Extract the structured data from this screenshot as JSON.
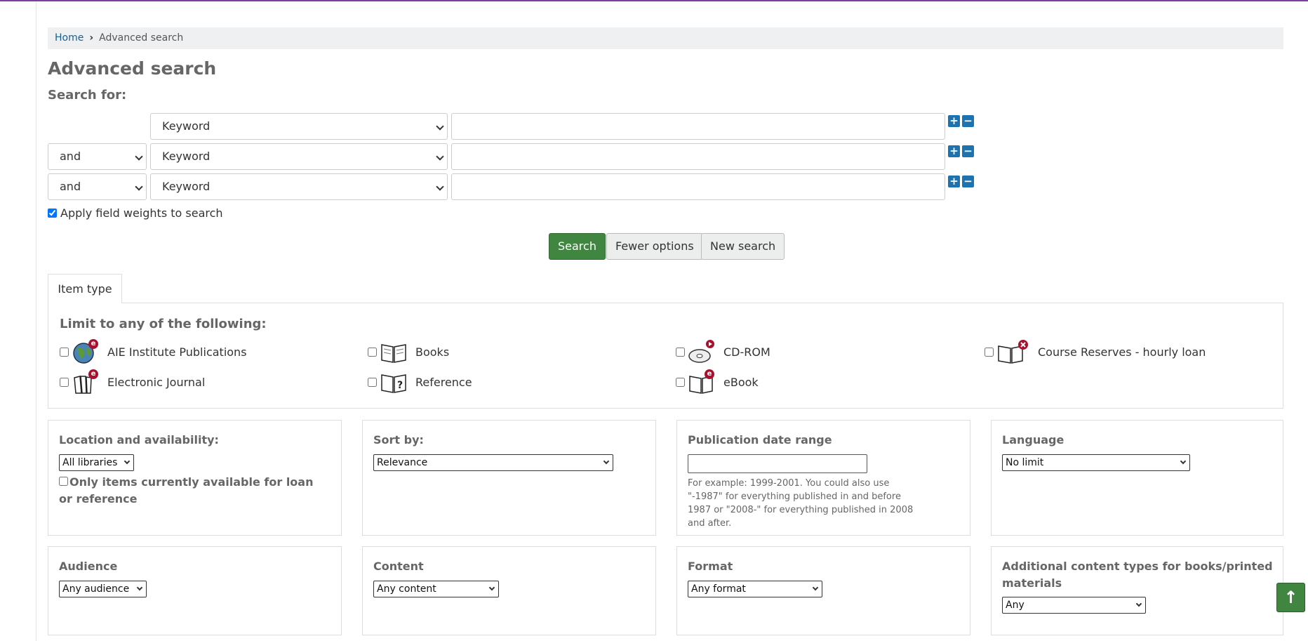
{
  "breadcrumb": {
    "home": "Home",
    "current": "Advanced search"
  },
  "page_title": "Advanced search",
  "search_for_label": "Search for:",
  "rows": [
    {
      "operator": "",
      "index": "Keyword",
      "term": ""
    },
    {
      "operator": "and",
      "index": "Keyword",
      "term": ""
    },
    {
      "operator": "and",
      "index": "Keyword",
      "term": ""
    }
  ],
  "plus": "+",
  "minus": "−",
  "apply_weights": "Apply field weights to search",
  "buttons": {
    "search": "Search",
    "fewer": "Fewer options",
    "new": "New search"
  },
  "tab_item_type": "Item type",
  "limit_label": "Limit to any of the following:",
  "item_types": [
    {
      "label": "AIE Institute Publications",
      "icon": "globe-e-icon"
    },
    {
      "label": "Books",
      "icon": "open-book-icon"
    },
    {
      "label": "CD-ROM",
      "icon": "cd-rom-icon"
    },
    {
      "label": "Course Reserves - hourly loan",
      "icon": "book-x-icon"
    },
    {
      "label": "Electronic Journal",
      "icon": "journal-e-icon"
    },
    {
      "label": "Reference",
      "icon": "reference-book-icon"
    },
    {
      "label": "eBook",
      "icon": "ebook-icon"
    }
  ],
  "location": {
    "label": "Location and availability:",
    "select": "All libraries",
    "only_available": "Only items currently available for loan or reference"
  },
  "sort": {
    "label": "Sort by:",
    "select": "Relevance"
  },
  "pubdate": {
    "label": "Publication date range",
    "value": "",
    "hint": "For example: 1999-2001. You could also use \"-1987\" for everything published in and before 1987 or \"2008-\" for everything published in 2008 and after."
  },
  "language": {
    "label": "Language",
    "select": "No limit"
  },
  "audience": {
    "label": "Audience",
    "select": "Any audience"
  },
  "content": {
    "label": "Content",
    "select": "Any content"
  },
  "format": {
    "label": "Format",
    "select": "Any format"
  },
  "additional": {
    "label": "Additional content types for books/printed materials",
    "select": "Any"
  },
  "back_to_top": "↑",
  "colors": {
    "accent": "#408540",
    "link": "#1a5f8f",
    "topbar": "#7b3fa0",
    "icon_button": "#1c73b0"
  }
}
